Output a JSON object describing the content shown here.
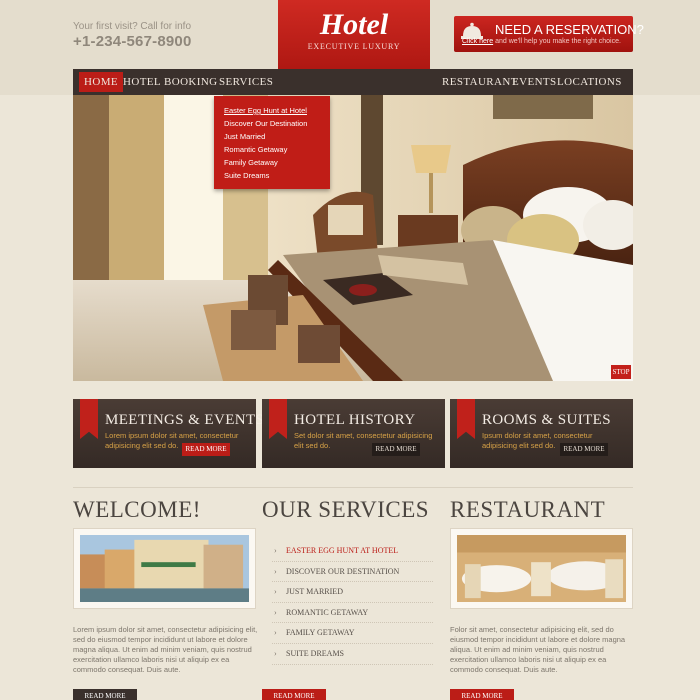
{
  "header": {
    "first_visit": "Your first visit? Call for info",
    "phone": "+1-234-567-8900",
    "logo_title": "Hotel",
    "logo_subtitle": "EXECUTIVE LUXURY",
    "reservation_title": "NEED A RESERVATION?",
    "reservation_link": "Click here",
    "reservation_rest": " and we'll help you make the right choice."
  },
  "nav": {
    "left": [
      "HOME",
      "HOTEL",
      "BOOKING",
      "SERVICES"
    ],
    "right": [
      "RESTAURANT",
      "EVENTS",
      "LOCATIONS"
    ],
    "active": "HOME"
  },
  "dropdown": [
    "Easter Egg Hunt at Hotel",
    "Discover Our Destination",
    "Just Married",
    "Romantic Getaway",
    "Family Getaway",
    "Suite Dreams"
  ],
  "slider": {
    "stop_label": "STOP"
  },
  "features": [
    {
      "title": "MEETINGS & EVENTS",
      "desc": "Lorem ipsum dolor sit amet, consectetur adipisicing elit sed do.",
      "button": "READ MORE"
    },
    {
      "title": "HOTEL HISTORY",
      "desc": "Set dolor sit amet, consectetur adipisicing elit sed do.",
      "button": "READ MORE"
    },
    {
      "title": "ROOMS & SUITES",
      "desc": "Ipsum dolor sit amet, consectetur adipisicing elit sed do.",
      "button": "READ MORE"
    }
  ],
  "welcome": {
    "title": "WELCOME!",
    "text": "Lorem ipsum dolor sit amet, consectetur adipisicing elit, sed do eiusmod tempor incididunt ut labore et dolore magna aliqua. Ut enim ad minim veniam, quis nostrud exercitation ullamco laboris nisi ut aliquip ex ea commodo consequat. Duis aute.",
    "button": "READ MORE"
  },
  "services": {
    "title": "OUR SERVICES",
    "items": [
      "EASTER EGG HUNT AT HOTEL",
      "DISCOVER OUR DESTINATION",
      "JUST MARRIED",
      "ROMANTIC GETAWAY",
      "FAMILY GETAWAY",
      "SUITE DREAMS"
    ],
    "active_index": 0,
    "button": "READ MORE"
  },
  "restaurant": {
    "title": "RESTAURANT",
    "text": "Folor sit amet, consectetur adipisicing elit, sed do eiusmod tempor incididunt ut labore et dolore magna aliqua. Ut enim ad minim veniam, quis nostrud exercitation ullamco laboris nisi ut aliquip ex ea commodo consequat. Duis aute.",
    "button": "READ MORE"
  },
  "colors": {
    "accent": "#bb1d17",
    "nav_bg": "#3a302c",
    "page_bg": "#ece6d8",
    "feature_text": "#d7a247"
  },
  "icons": [
    "bell-icon",
    "chevron-right-icon"
  ]
}
